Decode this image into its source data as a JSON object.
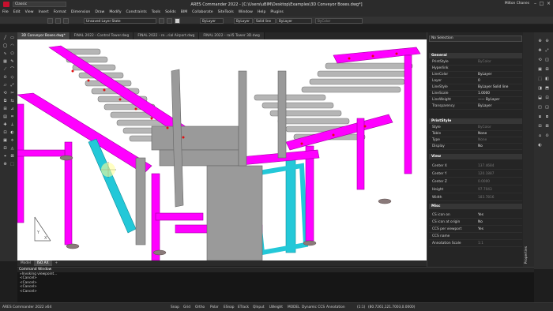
{
  "titlebar": {
    "workspace": "Classic",
    "title": "ARES Commander 2022 - [C:\\Users\\uBIM\\Desktop\\Examples\\3D Conveyor Boxes.dwg*]",
    "user": "Milton Chanes"
  },
  "menu": [
    "File",
    "Edit",
    "View",
    "Insert",
    "Format",
    "Dimension",
    "Draw",
    "Modify",
    "Constraints",
    "Tools",
    "Solids",
    "BIM",
    "Collaborate",
    "SiteTools",
    "Window",
    "Help",
    "Plugins"
  ],
  "toolbar": {
    "layer_state": "Unsaved Layer State",
    "color": "ByLayer",
    "layer": "ByLayer",
    "linestyle": "Solid line",
    "lineweight": "ByLayer",
    "plotstyle": "ByColor"
  },
  "doc_tabs": [
    {
      "label": "3D Conveyor Boxes.dwg*",
      "active": true
    },
    {
      "label": "FINAL 2022 - Control Tower.dwg",
      "active": false
    },
    {
      "label": "FINAL 2022 - re...rial Airport.dwg",
      "active": false
    },
    {
      "label": "FINAL 2022 - rail5 Tower 3D.dwg",
      "active": false
    }
  ],
  "layout_tabs": [
    {
      "label": "Model",
      "active": false
    },
    {
      "label": "ISO AX",
      "active": true
    },
    {
      "label": "+",
      "active": false
    }
  ],
  "command_window": {
    "header": "Command Window",
    "lines": [
      "<Cancel>",
      "<Cancel>",
      "<Cancel>",
      "<Cancel>"
    ],
    "first_line": "»Invoking viewpoint..."
  },
  "properties": {
    "selection": "No Selection",
    "sections": [
      {
        "name": "General",
        "rows": [
          {
            "k": "PrintStyle",
            "v": "ByColor",
            "dim": true
          },
          {
            "k": "Hyperlink",
            "v": "",
            "dim": false
          },
          {
            "k": "LineColor",
            "v": "ByLayer",
            "dim": false
          },
          {
            "k": "Layer",
            "v": "0",
            "dim": false
          },
          {
            "k": "LineStyle",
            "v": "ByLayer    Solid line",
            "dim": false
          },
          {
            "k": "LineScale",
            "v": "1.0000",
            "dim": false
          },
          {
            "k": "LineWeight",
            "v": "—— ByLayer",
            "dim": false
          },
          {
            "k": "Transparency",
            "v": "ByLayer",
            "dim": false
          }
        ]
      },
      {
        "name": "PrintStyle",
        "rows": [
          {
            "k": "Style",
            "v": "ByColor",
            "dim": true
          },
          {
            "k": "Table",
            "v": "None",
            "dim": false
          },
          {
            "k": "Type",
            "v": "None",
            "dim": true
          },
          {
            "k": "Display",
            "v": "No",
            "dim": false
          }
        ]
      },
      {
        "name": "View",
        "rows": [
          {
            "k": "Center X",
            "v": "137.4684",
            "dim": true
          },
          {
            "k": "Center Y",
            "v": "120.1887",
            "dim": true
          },
          {
            "k": "Center Z",
            "v": "0.0000",
            "dim": true
          },
          {
            "k": "Height",
            "v": "97.7043",
            "dim": true
          },
          {
            "k": "Width",
            "v": "183.7816",
            "dim": true
          }
        ]
      },
      {
        "name": "Misc",
        "rows": [
          {
            "k": "CS icon on",
            "v": "Yes",
            "dim": false
          },
          {
            "k": "CS icon at origin",
            "v": "No",
            "dim": false
          },
          {
            "k": "CCS per viewport",
            "v": "Yes",
            "dim": false
          },
          {
            "k": "CCS name",
            "v": "",
            "dim": false
          },
          {
            "k": "Annotation Scale",
            "v": "1:1",
            "dim": true
          }
        ]
      }
    ],
    "side_label": "Properties"
  },
  "statusbar": {
    "app": "ARES Commander 2022 x64",
    "toggles": [
      "Snap",
      "Grid",
      "Ortho",
      "Polar",
      "ESnap",
      "ETrack",
      "QInput",
      "LWeight",
      "MODEL",
      "Dynamic CCS",
      "Annotation"
    ],
    "scale": "(1:1)",
    "coords": "(80.7261,121.7003,0.0000)"
  },
  "colors": {
    "magenta_frame": "#ff00ff",
    "cyan_frame": "#23c8d8",
    "roller_gray": "#a7a7a7"
  }
}
